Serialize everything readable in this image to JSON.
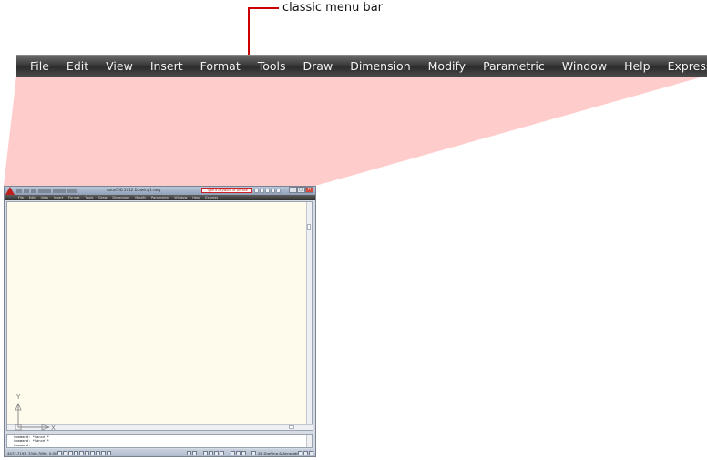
{
  "annotation": {
    "label": "classic menu bar",
    "accent_color": "#cc0000",
    "wedge_color": "#ffcccc"
  },
  "menu_bar": {
    "items": [
      "File",
      "Edit",
      "View",
      "Insert",
      "Format",
      "Tools",
      "Draw",
      "Dimension",
      "Modify",
      "Parametric",
      "Window",
      "Help",
      "Express"
    ]
  },
  "app": {
    "title": "AutoCAD 2012   Drawing1.dwg",
    "search_placeholder": "Type a keyword or phrase",
    "window_buttons": [
      "–",
      "□",
      "✕"
    ],
    "logo_icon": "autocad-logo-icon",
    "canvas_color": "#fefbec",
    "ucs": {
      "y_label": "Y",
      "x_label": "X"
    },
    "command_lines": [
      "Command: *Cancel*",
      "Command: *Cancel*",
      "",
      "Command:"
    ],
    "status": {
      "coordinates": "4472.7193, 3346.7896, 0.0000",
      "workspace": "2D Drafting & Annotation"
    }
  }
}
